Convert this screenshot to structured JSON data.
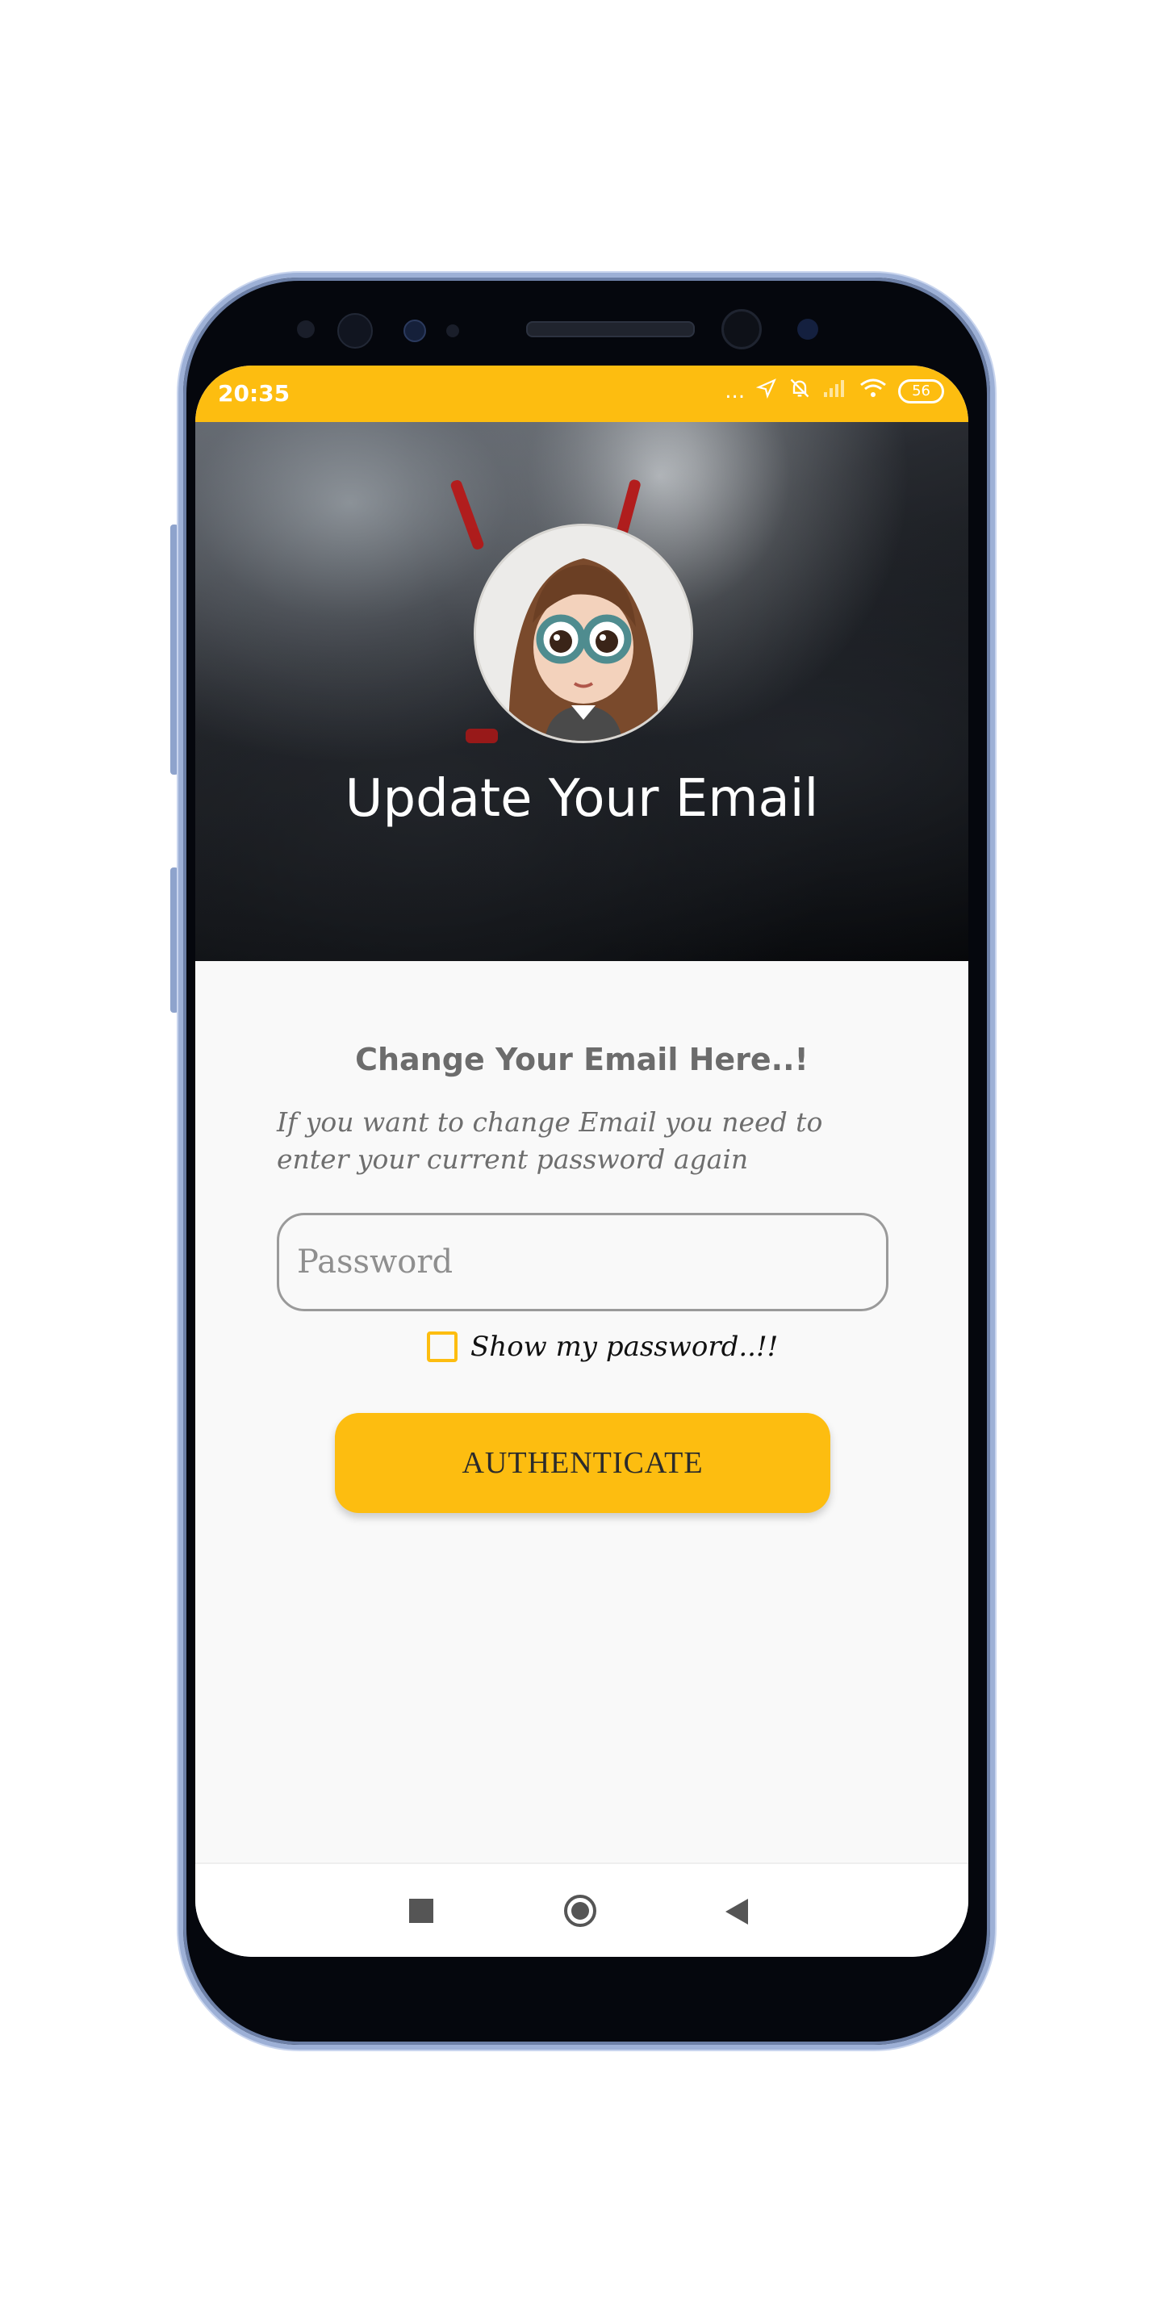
{
  "status_bar": {
    "time": "20:35",
    "dots": "...",
    "battery": "56"
  },
  "header": {
    "title": "Update Your Email"
  },
  "form": {
    "subtitle": "Change Your Email Here..!",
    "description": "If you want to change Email you need to enter your current password again",
    "password_placeholder": "Password",
    "password_value": "",
    "show_password_label": "Show my password..!!",
    "show_password_checked": false,
    "submit_label": "AUTHENTICATE"
  },
  "colors": {
    "accent": "#fdbd10",
    "background": "#f9f9f9"
  }
}
